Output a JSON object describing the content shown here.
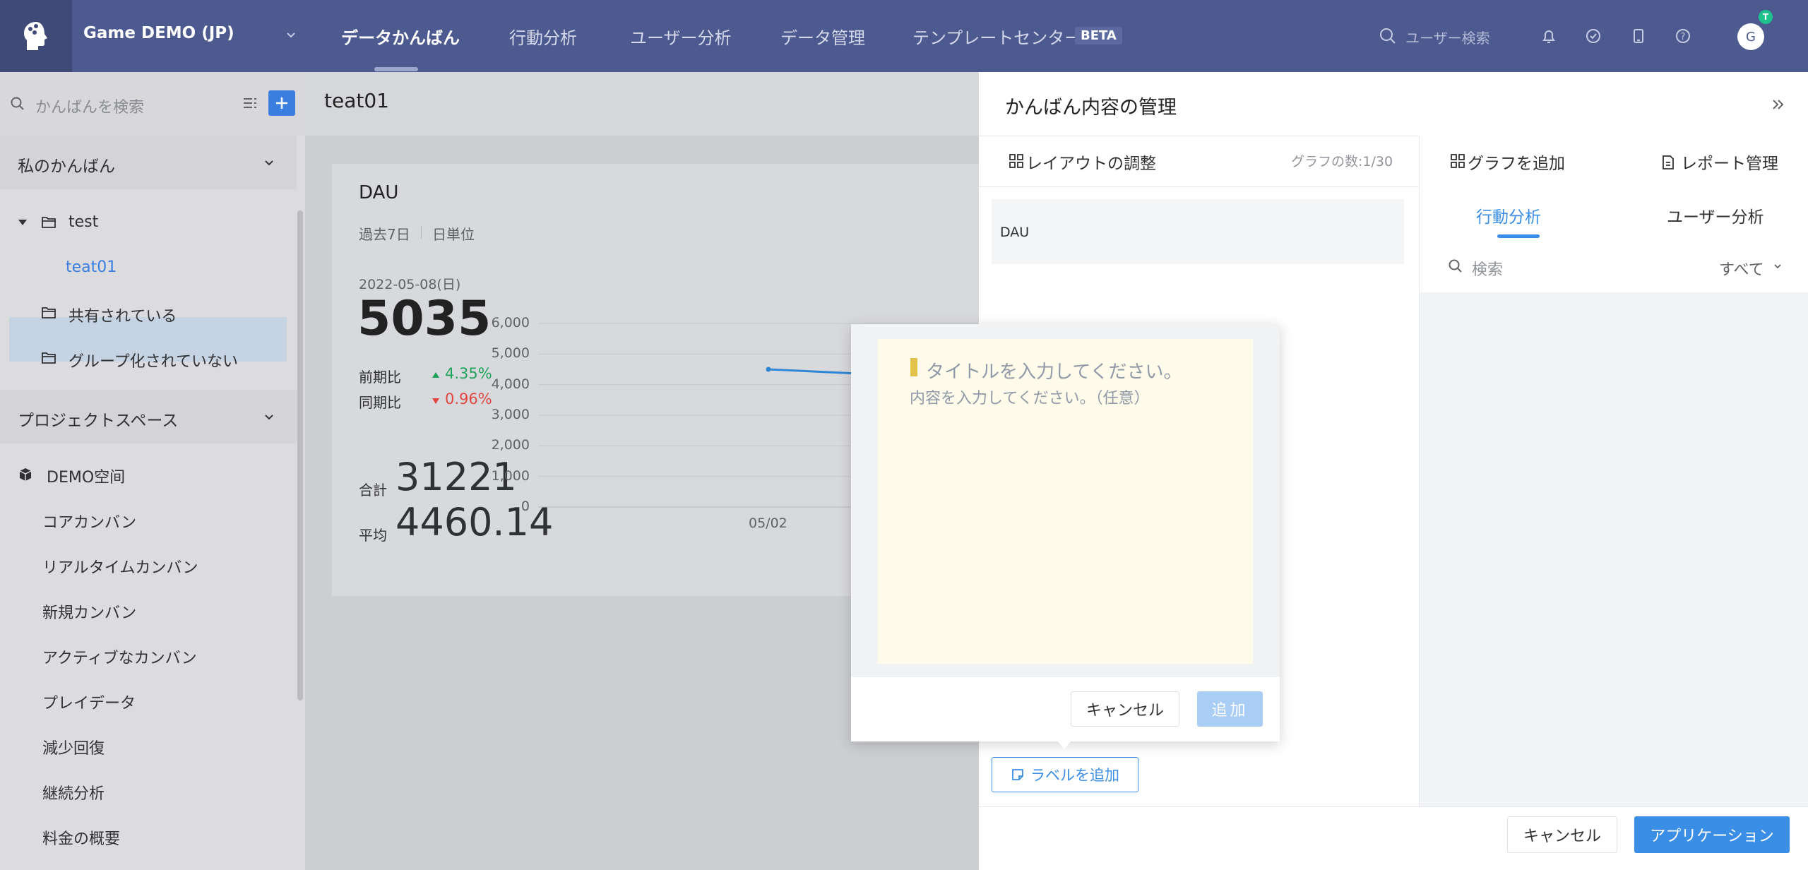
{
  "topbar": {
    "project": "Game DEMO (JP)",
    "nav": [
      "データかんばん",
      "行動分析",
      "ユーザー分析",
      "データ管理",
      "テンプレートセンター"
    ],
    "beta": "BETA",
    "search_placeholder": "ユーザー検索",
    "avatar": "G",
    "avatar_badge": "T"
  },
  "sidebar": {
    "search_placeholder": "かんばんを検索",
    "my_kanban": "私のかんばん",
    "folders": {
      "test": "test",
      "teat01": "teat01",
      "shared": "共有されている",
      "ungrouped": "グループ化されていない"
    },
    "project_space": "プロジェクトスペース",
    "demo_space": "DEMO空间",
    "items": [
      "コアカンバン",
      "リアルタイムカンバン",
      "新規カンバン",
      "アクティブなカンバン",
      "プレイデータ",
      "減少回復",
      "継続分析",
      "料金の概要"
    ]
  },
  "main": {
    "title": "teat01",
    "card": {
      "title": "DAU",
      "range": "過去7日",
      "unit": "日単位",
      "date": "2022-05-08(日)",
      "value": "5035",
      "prev_label": "前期比",
      "prev_value": "4.35%",
      "same_label": "同期比",
      "same_value": "0.96%",
      "total_label": "合計",
      "total_value": "31221",
      "avg_label": "平均",
      "avg_value": "4460.14"
    }
  },
  "chart_data": {
    "type": "line",
    "x": [
      "05/02"
    ],
    "series": [
      {
        "values": [
          4500
        ]
      }
    ],
    "yticks": [
      "6,000",
      "5,000",
      "4,000",
      "3,000",
      "2,000",
      "1,000",
      "0"
    ],
    "xticks": [
      "05/02"
    ],
    "ylim": [
      0,
      6000
    ]
  },
  "panel": {
    "title": "かんばん内容の管理",
    "layout_adjust": "レイアウトの調整",
    "graph_count": "グラフの数:1/30",
    "dau_item": "DAU",
    "add_graph": "グラフを追加",
    "report_manage": "レポート管理",
    "tabs": [
      "行動分析",
      "ユーザー分析"
    ],
    "search_placeholder": "検索",
    "filter": "すべて",
    "add_label": "ラベルを追加",
    "cancel": "キャンセル",
    "apply": "アプリケーション"
  },
  "popover": {
    "title_placeholder": "タイトルを入力してください。",
    "body_placeholder": "内容を入力してください。（任意）",
    "cancel": "キャンセル",
    "add": "追加"
  },
  "colors": {
    "topbar": "#4d5a8f",
    "accent": "#3a8ee6",
    "positive": "#1fa35c",
    "negative": "#e0463f"
  }
}
